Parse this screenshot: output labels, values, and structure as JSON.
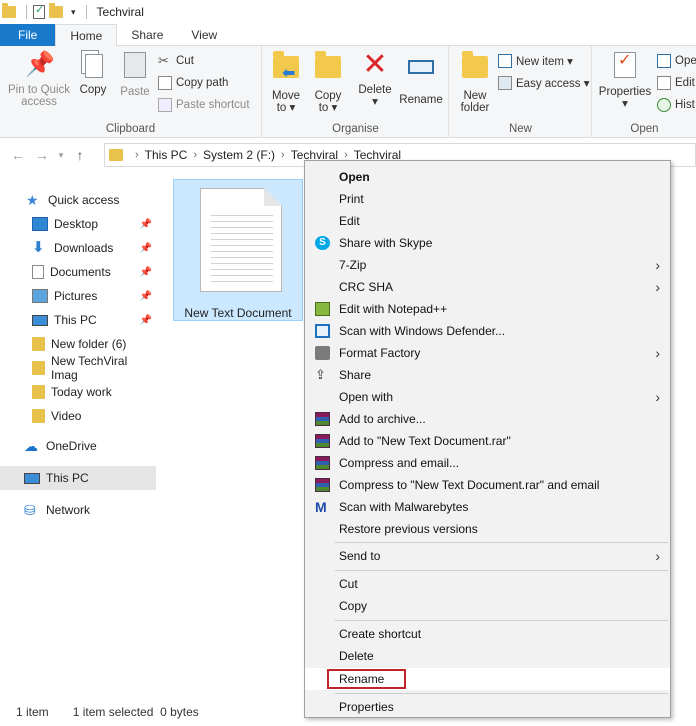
{
  "window": {
    "title": "Techviral"
  },
  "tabs": [
    "File",
    "Home",
    "Share",
    "View"
  ],
  "ribbon": {
    "clipboard": {
      "label": "Clipboard",
      "pin_label_1": "Pin to Quick",
      "pin_label_2": "access",
      "copy": "Copy",
      "paste": "Paste",
      "cut": "Cut",
      "copy_path": "Copy path",
      "paste_shortcut": "Paste shortcut"
    },
    "organise": {
      "label": "Organise",
      "move_to_1": "Move",
      "move_to_2": "to ▾",
      "copy_to_1": "Copy",
      "copy_to_2": "to ▾",
      "delete_1": "Delete",
      "delete_2": "▾",
      "rename": "Rename"
    },
    "new": {
      "label": "New",
      "new_folder_1": "New",
      "new_folder_2": "folder",
      "new_item": "New item ▾",
      "easy_access": "Easy access ▾"
    },
    "open": {
      "label": "Open",
      "properties_1": "Properties",
      "properties_2": "▾",
      "open_short": "Ope",
      "edit_short": "Edit",
      "history_short": "Hist"
    }
  },
  "address": {
    "crumbs": [
      "This PC",
      "System 2 (F:)",
      "Techviral",
      "Techviral"
    ]
  },
  "nav": {
    "items": [
      {
        "label": "Quick access",
        "icon": "star-icon"
      },
      {
        "label": "Desktop",
        "icon": "desktop-icon",
        "pinned": true
      },
      {
        "label": "Downloads",
        "icon": "download-icon",
        "pinned": true
      },
      {
        "label": "Documents",
        "icon": "documents-icon",
        "pinned": true
      },
      {
        "label": "Pictures",
        "icon": "pictures-icon",
        "pinned": true
      },
      {
        "label": "This PC",
        "icon": "computer-icon",
        "pinned": true
      },
      {
        "label": "New folder (6)",
        "icon": "folder-icon"
      },
      {
        "label": "New TechViral Imag",
        "icon": "folder-icon"
      },
      {
        "label": "Today work",
        "icon": "folder-icon"
      },
      {
        "label": "Video",
        "icon": "folder-icon"
      },
      {
        "label": "OneDrive",
        "icon": "cloud-icon"
      },
      {
        "label": "This PC",
        "icon": "computer-icon",
        "selected": true
      },
      {
        "label": "Network",
        "icon": "network-icon"
      }
    ]
  },
  "file": {
    "name": "New Text Document"
  },
  "status": {
    "count": "1 item",
    "selection": "1 item selected  0 bytes"
  },
  "context_menu": {
    "items": [
      "Open",
      "Print",
      "Edit",
      "Share with Skype",
      "7-Zip",
      "CRC SHA",
      "Edit with Notepad++",
      "Scan with Windows Defender...",
      "Format Factory",
      "Share",
      "Open with",
      "Add to archive...",
      "Add to \"New Text Document.rar\"",
      "Compress and email...",
      "Compress to \"New Text Document.rar\" and email",
      "Scan with Malwarebytes",
      "Restore previous versions",
      "Send to",
      "Cut",
      "Copy",
      "Create shortcut",
      "Delete",
      "Rename",
      "Properties"
    ]
  }
}
